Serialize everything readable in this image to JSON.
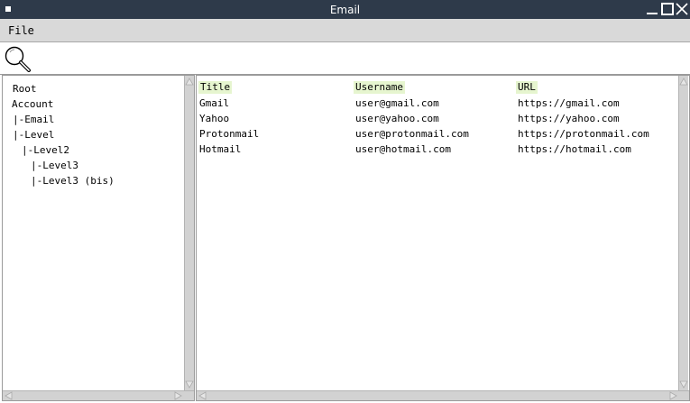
{
  "window": {
    "title": "Email"
  },
  "menu": {
    "file_label": "File"
  },
  "toolbar": {
    "search_icon": "search-icon"
  },
  "tree": {
    "items": [
      {
        "label": "Root"
      },
      {
        "label": "Account"
      },
      {
        "label": "|-Email"
      },
      {
        "label": "|-Level"
      },
      {
        "label": "|-Level2"
      },
      {
        "label": "|-Level3"
      },
      {
        "label": "|-Level3 (bis)"
      }
    ]
  },
  "table": {
    "columns": [
      "Title",
      "Username",
      "URL"
    ],
    "header_color": "#e6f5cf",
    "rows": [
      {
        "title": "Gmail",
        "username": "user@gmail.com",
        "url": "https://gmail.com"
      },
      {
        "title": "Yahoo",
        "username": "user@yahoo.com",
        "url": "https://yahoo.com"
      },
      {
        "title": "Protonmail",
        "username": "user@protonmail.com",
        "url": "https://protonmail.com"
      },
      {
        "title": "Hotmail",
        "username": "user@hotmail.com",
        "url": "https://hotmail.com"
      }
    ]
  }
}
